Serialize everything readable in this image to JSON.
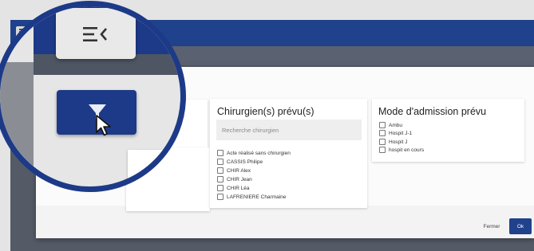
{
  "colors": {
    "primary": "#20418c",
    "ring": "#1d3a88",
    "overlay": "#545b66",
    "panel": "#ffffff"
  },
  "icons": [
    "menu-icon",
    "filter-icon",
    "cursor-icon"
  ],
  "surgeons": {
    "title": "Chirurgien(s) prévu(s)",
    "search_placeholder": "Recherche chirurgien",
    "options": [
      "Acte réalisé sans chirurgien",
      "CASSIS Philipe",
      "CHIR Alex",
      "CHIR Jean",
      "CHIR Léa",
      "LAFRENIERE Charmaine"
    ]
  },
  "admission": {
    "title": "Mode d'admission prévu",
    "options": [
      "Ambu",
      "Hospit J-1",
      "Hospit J",
      "hospit en cours"
    ]
  },
  "footer": {
    "close_label": "Fermer",
    "ok_label": "Ok"
  }
}
